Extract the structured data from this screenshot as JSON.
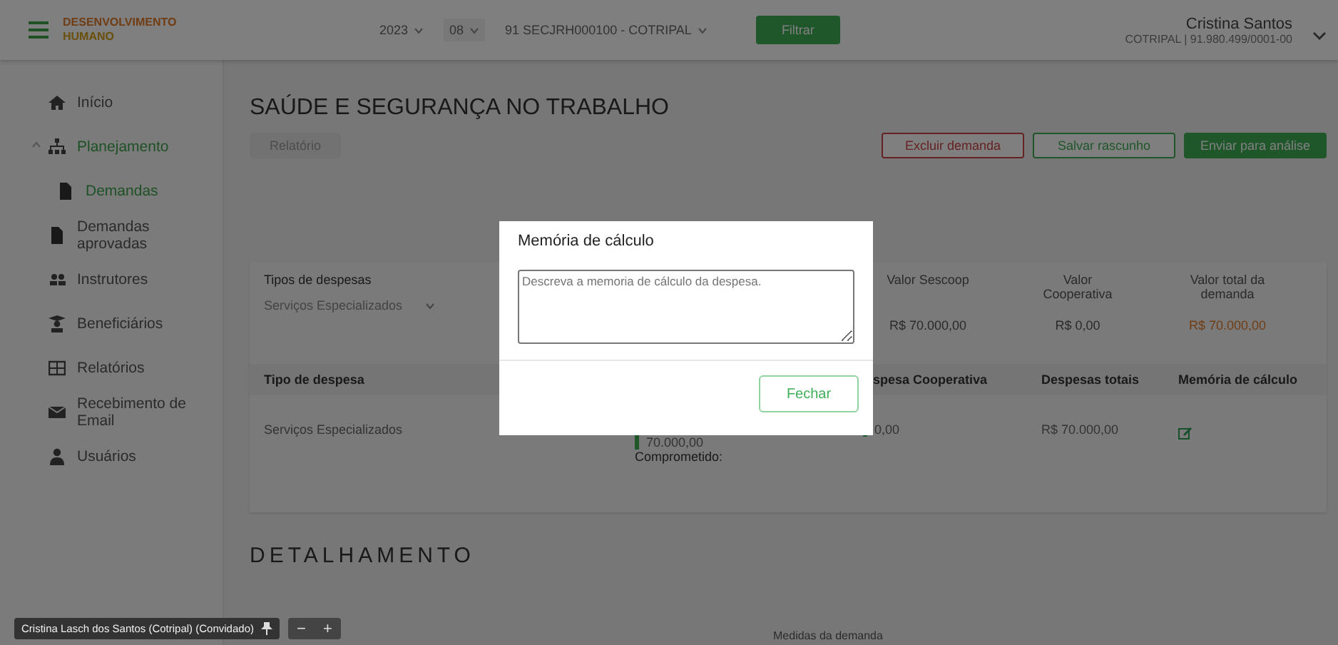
{
  "header": {
    "logo": {
      "line1": "DESENVOLVIMENTO",
      "line2": "HUMANO"
    },
    "filters": [
      {
        "value": "2023"
      },
      {
        "value": "08"
      },
      {
        "value": "91 SECJRH000100 - COTRIPAL"
      }
    ],
    "filter_button": "Filtrar",
    "user": {
      "name": "Cristina Santos",
      "detail": "COTRIPAL | 91.980.499/0001-00"
    }
  },
  "sidebar": {
    "items": [
      {
        "label": "Início",
        "selected": false
      },
      {
        "label": "Planejamento",
        "selected": true,
        "expanded": true,
        "children": [
          {
            "label": "Demandas",
            "selected": true
          }
        ]
      },
      {
        "label": "Demandas aprovadas",
        "selected": false
      },
      {
        "label": "Instrutores",
        "selected": false
      },
      {
        "label": "Beneficiários",
        "selected": false
      },
      {
        "label": "Relatórios",
        "selected": false
      },
      {
        "label": "Recebimento de Email",
        "selected": false
      },
      {
        "label": "Usuários",
        "selected": false
      }
    ]
  },
  "page": {
    "title": "SAÚDE E SEGURANÇA NO TRABALHO",
    "report_button": {
      "label": "Relatório",
      "disabled": true
    },
    "actions": [
      {
        "label": "Excluir demanda",
        "kind": "danger"
      },
      {
        "label": "Salvar rascunho",
        "kind": "outline"
      },
      {
        "label": "Enviar para análise",
        "kind": "primary"
      }
    ]
  },
  "expenses": {
    "type_label": "Tipos de despesas",
    "type_value": "Serviços Especializados",
    "totals": [
      {
        "label": "Valor Sescoop",
        "value": "R$ 70.000,00",
        "highlight": false
      },
      {
        "label": "Valor Cooperativa",
        "value": "R$ 0,00",
        "highlight": false
      },
      {
        "label": "Valor total da demanda",
        "value": "R$ 70.000,00",
        "highlight": true
      }
    ],
    "table": {
      "columns": [
        "Tipo de despesa",
        "spesa Cooperativa",
        "Despesas totais",
        "Memória de cálculo"
      ],
      "rows": [
        {
          "type": "Serviços Especializados",
          "sescoop": "70.000,00",
          "sescoop_note": "Comprometido:",
          "cooperativa": "0,00",
          "total": "R$ 70.000,00"
        }
      ]
    }
  },
  "detail": {
    "title": "DETALHAMENTO",
    "label": "Medidas da demanda"
  },
  "modal": {
    "title": "Memória de cálculo",
    "placeholder": "Descreva a memoria de cálculo da despesa.",
    "close": "Fechar"
  },
  "call_bar": {
    "name": "Cristina Lasch dos Santos (Cotripal) (Convidado)",
    "zoom_out": "−",
    "zoom_in": "+"
  }
}
